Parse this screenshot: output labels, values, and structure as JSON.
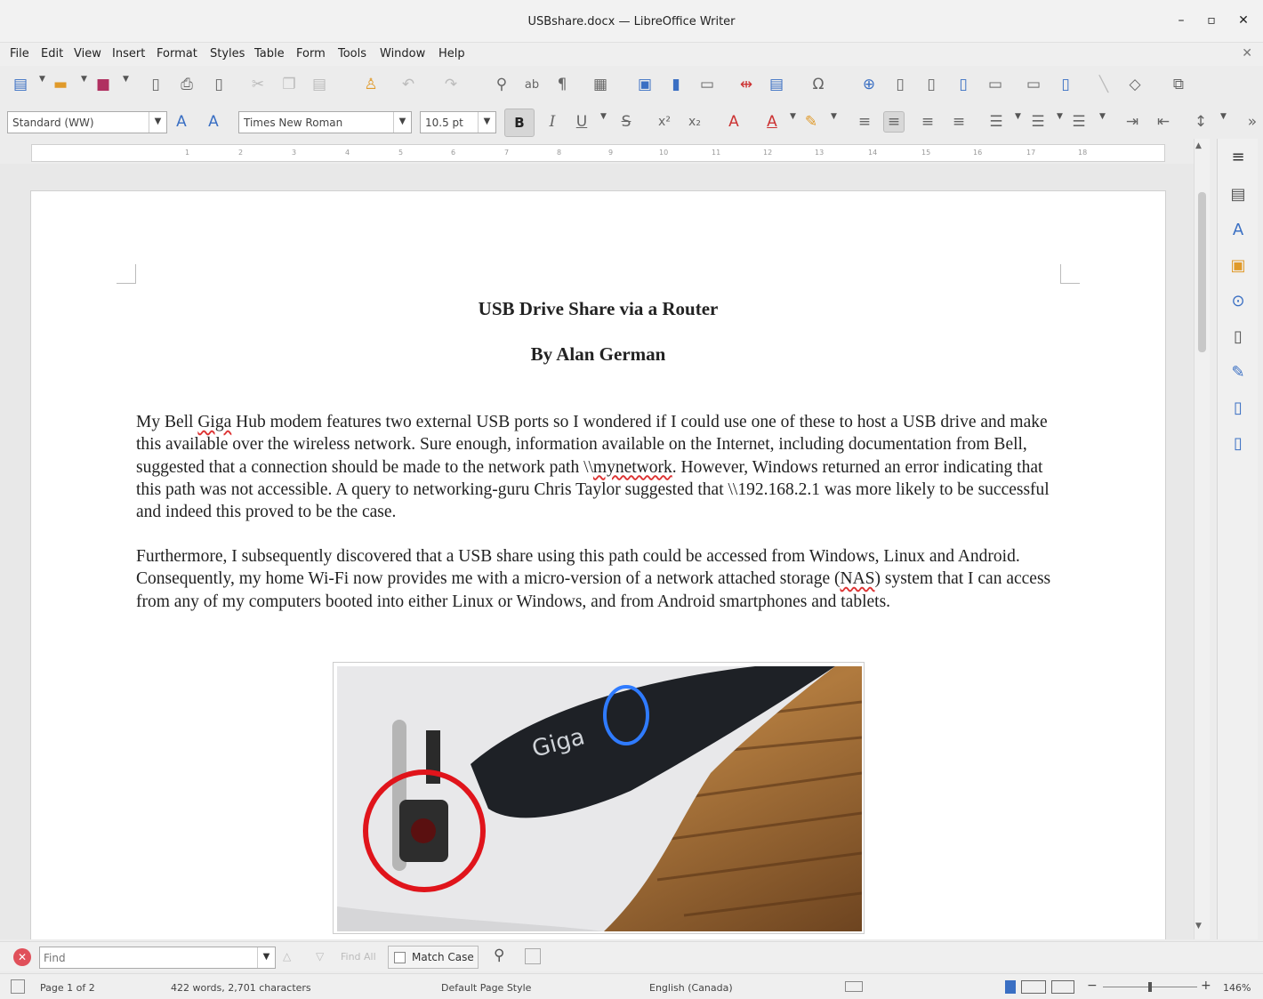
{
  "window": {
    "title": "USBshare.docx — LibreOffice Writer",
    "minimize": "–",
    "maximize": "▫",
    "close": "✕"
  },
  "menu": [
    "File",
    "Edit",
    "View",
    "Insert",
    "Format",
    "Styles",
    "Table",
    "Form",
    "Tools",
    "Window",
    "Help"
  ],
  "menu_close": "✕",
  "formatting": {
    "paragraph_style": "Standard (WW)",
    "font_name": "Times New Roman",
    "font_size": "10.5 pt",
    "bold": "B",
    "italic": "I",
    "underline": "U",
    "strike": "S"
  },
  "ruler_marks": [
    "1",
    "2",
    "3",
    "4",
    "5",
    "6",
    "7",
    "8",
    "9",
    "10",
    "11",
    "12",
    "13",
    "14",
    "15",
    "16",
    "17",
    "18"
  ],
  "document": {
    "title": "USB Drive Share via a Router",
    "byline": "By Alan German",
    "p1": {
      "a": "My Bell ",
      "b": "Giga",
      "c": " Hub modem features two external USB ports so I wondered if I could use one of these to host a USB drive and make this available over the wireless network.  Sure enough, information available on the Internet, including documentation from Bell, suggested that a connection should be made to the network path \\\\",
      "d": "mynetwork",
      "e": ".  However, Windows returned an error indicating that this path was not accessible.  A query to networking-guru Chris Taylor suggested that \\\\192.168.2.1 was more likely to be successful and indeed this proved to be the case."
    },
    "p2": {
      "a": "Furthermore, I subsequently discovered that a USB share using this path could be accessed from Windows, Linux and Android.  Consequently, my home Wi-Fi now provides me with a micro-version of a network attached storage (",
      "b": "NAS",
      "c": ") system that I can access from any of my computers booted into either Linux or Windows, and from Android smartphones and tablets."
    },
    "photo_logo": "Giga"
  },
  "find": {
    "placeholder": "Find",
    "find_all": "Find All",
    "match_case": "Match Case"
  },
  "status": {
    "page": "Page 1 of 2",
    "words": "422 words, 2,701 characters",
    "page_style": "Default Page Style",
    "language": "English (Canada)",
    "zoom": "146%"
  }
}
